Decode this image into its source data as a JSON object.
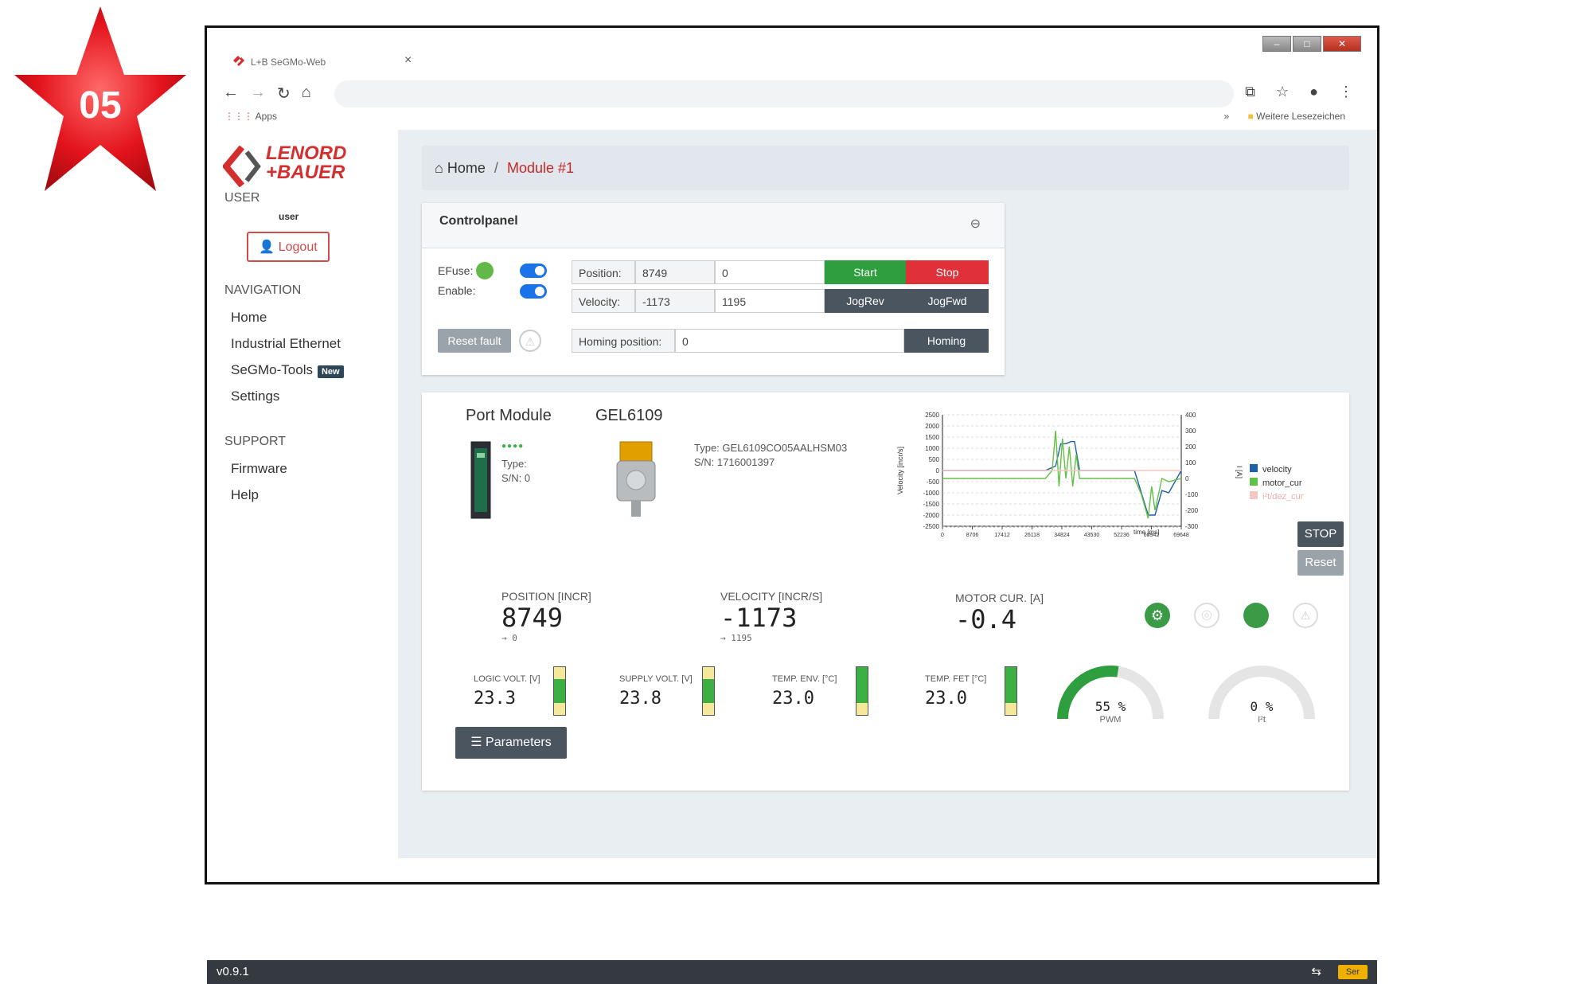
{
  "badge": {
    "number": "05"
  },
  "browser": {
    "tab_title": "L+B SeGMo-Web",
    "tab_close": "×",
    "apps_label": "Apps",
    "bookmarks_more": "»",
    "bookmarks_label": "Weitere Lesezeichen"
  },
  "logo": {
    "line1": "LENORD",
    "line2": "+BAUER"
  },
  "sidebar": {
    "user_title": "USER",
    "user_name": "user",
    "logout_label": "Logout",
    "navigation_title": "NAVIGATION",
    "nav_items": [
      {
        "label": "Home"
      },
      {
        "label": "Industrial Ethernet"
      },
      {
        "label": "SeGMo-Tools",
        "badge": "New"
      },
      {
        "label": "Settings"
      }
    ],
    "support_title": "SUPPORT",
    "support_items": [
      {
        "label": "Firmware"
      },
      {
        "label": "Help"
      }
    ]
  },
  "breadcrumb": {
    "home": "Home",
    "separator": "/",
    "current": "Module #1"
  },
  "controlpanel": {
    "title": "Controlpanel",
    "efuse_label": "EFuse:",
    "enable_label": "Enable:",
    "position_label": "Position:",
    "position_value": "8749",
    "position_input": "0",
    "velocity_label": "Velocity:",
    "velocity_value": "-1173",
    "velocity_input": "1195",
    "start_label": "Start",
    "stop_label": "Stop",
    "jogrev_label": "JogRev",
    "jogfwd_label": "JogFwd",
    "reset_fault_label": "Reset fault",
    "homing_position_label": "Homing position:",
    "homing_position_value": "0",
    "homing_label": "Homing"
  },
  "module": {
    "port_module_title": "Port Module",
    "port_type_label": "Type:",
    "port_sn_label": "S/N: 0",
    "device_title": "GEL6109",
    "device_type": "Type: GEL6109CO05AALHSM03",
    "device_sn": "S/N: 1716001397",
    "position_label": "POSITION [INCR]",
    "position_value": "8749",
    "position_target": "→ 0",
    "velocity_label": "VELOCITY [INCR/S]",
    "velocity_value": "-1173",
    "velocity_target": "→ 1195",
    "motorcur_label": "MOTOR CUR. [A]",
    "motorcur_value": "-0.4",
    "logic_volt_label": "LOGIC VOLT. [V]",
    "logic_volt_value": "23.3",
    "supply_volt_label": "SUPPLY VOLT. [V]",
    "supply_volt_value": "23.8",
    "temp_env_label": "TEMP. ENV. [°C]",
    "temp_env_value": "23.0",
    "temp_fet_label": "TEMP. FET [°C]",
    "temp_fet_value": "23.0",
    "pwm_value": "55 %",
    "pwm_label": "PWM",
    "pwm_fraction": 0.55,
    "pt_value": "0 %",
    "pt_label": "I²t",
    "pt_fraction": 0.0,
    "parameters_label": "Parameters",
    "chart_stop_label": "STOP",
    "chart_reset_label": "Reset"
  },
  "chart_data": {
    "type": "line",
    "xlabel": "time [ms]",
    "ylabel": "Velocity [incr/s]",
    "y2label": "I [A]",
    "x_ticks": [
      "0",
      "8706",
      "17412",
      "26118",
      "34824",
      "43530",
      "52236",
      "60942",
      "69648"
    ],
    "y_ticks": [
      "2500",
      "2000",
      "1500",
      "1000",
      "500",
      "0",
      "-500",
      "-1000",
      "-1500",
      "-2000",
      "-2500"
    ],
    "y2_ticks": [
      "400",
      "300",
      "200",
      "100",
      "0",
      "-100",
      "-200",
      "-300"
    ],
    "ylim": [
      -2500,
      2500
    ],
    "y2lim": [
      -300,
      400
    ],
    "xlim": [
      0,
      69648
    ],
    "grid": true,
    "legend_position": "right",
    "series": [
      {
        "name": "velocity",
        "color": "#1f5fa8",
        "x": [
          0,
          30000,
          33000,
          34500,
          36000,
          37500,
          38500,
          40000,
          41000,
          42000,
          56000,
          60000,
          62000,
          64000,
          66000,
          69648
        ],
        "y": [
          0,
          0,
          200,
          1200,
          1200,
          1300,
          1300,
          0,
          0,
          0,
          0,
          -2000,
          -2000,
          -900,
          -1000,
          0
        ]
      },
      {
        "name": "motor_cur",
        "color": "#62c046",
        "x": [
          0,
          30000,
          32000,
          33000,
          34000,
          35000,
          36000,
          37000,
          38000,
          39000,
          40000,
          42000,
          56000,
          58000,
          60000,
          61000,
          62000,
          63000,
          64000,
          66000,
          69648
        ],
        "y": [
          0,
          0,
          50,
          300,
          -50,
          250,
          0,
          200,
          -50,
          150,
          0,
          0,
          0,
          -100,
          -250,
          -50,
          -200,
          -100,
          0,
          -20,
          0
        ]
      },
      {
        "name": "i²t/dez_cur",
        "color": "#f4c7c3",
        "x": [
          0,
          69648
        ],
        "y": [
          0,
          0
        ]
      }
    ]
  },
  "statusbar": {
    "version": "v0.9.1",
    "ser_label": "Ser"
  },
  "colors": {
    "accent_red": "#d32f2f",
    "green": "#2e9e3e",
    "dark_button": "#4a5560"
  }
}
